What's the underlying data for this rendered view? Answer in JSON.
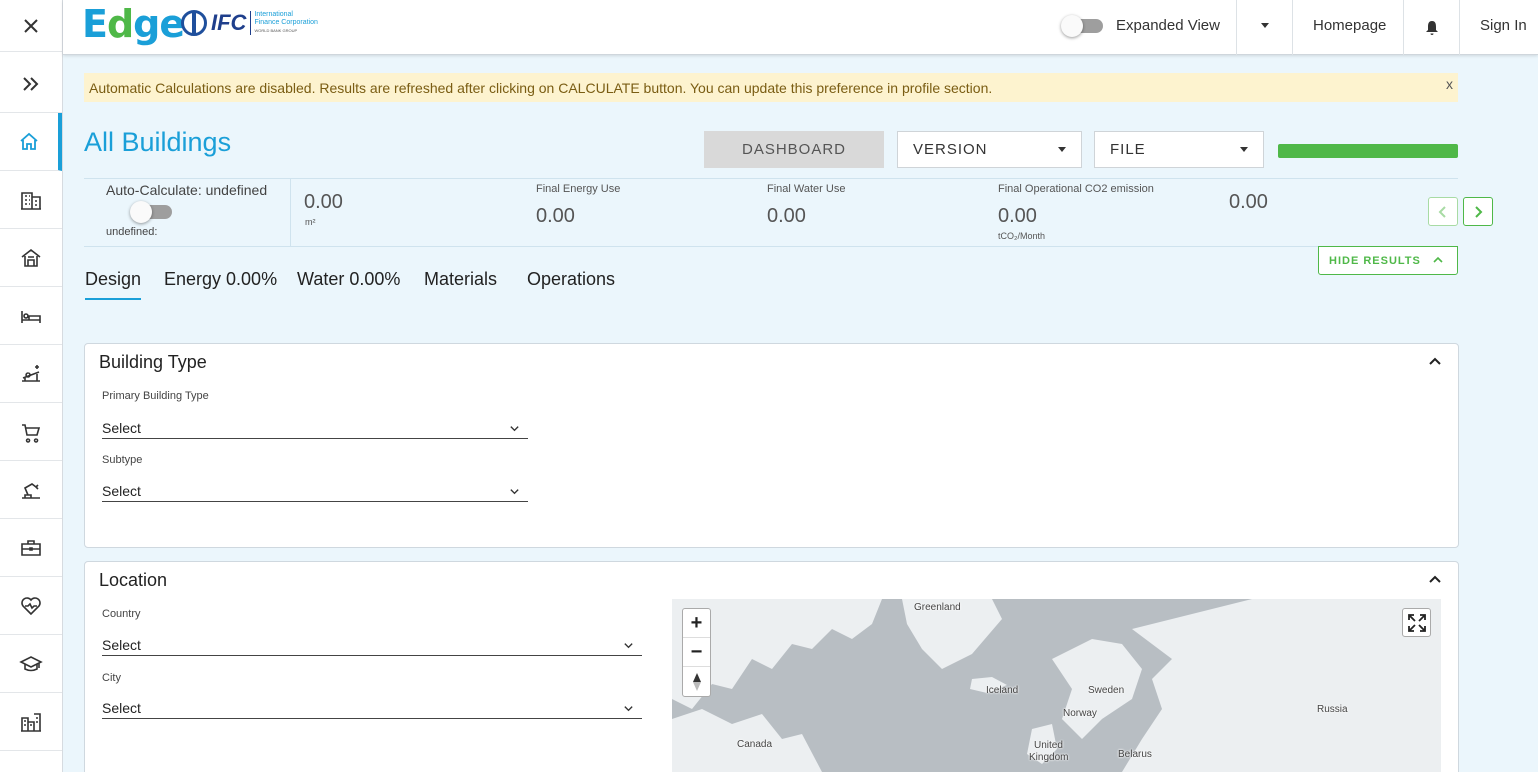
{
  "header": {
    "logo_text_e": "E",
    "logo_text_d": "d",
    "logo_text_ge": "ge",
    "ifc_text": "IFC",
    "ifc_sub1": "International",
    "ifc_sub2": "Finance Corporation",
    "ifc_sub3": "WORLD BANK GROUP",
    "expanded_view_label": "Expanded View",
    "homepage_label": "Homepage",
    "sign_in_label": "Sign In"
  },
  "banner": {
    "message": "Automatic Calculations are disabled. Results are refreshed after clicking on CALCULATE button. You can update this preference in profile section.",
    "close": "x"
  },
  "page": {
    "title": "All Buildings",
    "dashboard_label": "DASHBOARD",
    "version_label": "VERSION",
    "file_label": "FILE",
    "progress_fraction": 1.0
  },
  "stats": {
    "auto_calc_label": "Auto-Calculate: undefined",
    "auto_calc_sub": "undefined:",
    "area_value": "0.00",
    "area_unit": "m²",
    "energy_label": "Final Energy Use",
    "energy_value": "0.00",
    "water_label": "Final Water Use",
    "water_value": "0.00",
    "co2_label": "Final Operational CO2 emission",
    "co2_value": "0.00",
    "co2_unit": "tCO₂/Month",
    "extra_value": "0.00",
    "hide_results_label": "HIDE RESULTS"
  },
  "tabs": [
    {
      "label": "Design"
    },
    {
      "label": "Energy 0.00%"
    },
    {
      "label": "Water 0.00%"
    },
    {
      "label": "Materials"
    },
    {
      "label": "Operations"
    }
  ],
  "building_type": {
    "title": "Building Type",
    "primary_label": "Primary Building Type",
    "primary_value": "Select",
    "subtype_label": "Subtype",
    "subtype_value": "Select"
  },
  "location": {
    "title": "Location",
    "country_label": "Country",
    "country_value": "Select",
    "city_label": "City",
    "city_value": "Select",
    "map_labels": {
      "greenland": "Greenland",
      "iceland": "Iceland",
      "sweden": "Sweden",
      "norway": "Norway",
      "russia": "Russia",
      "canada": "Canada",
      "uk1": "United",
      "uk2": "Kingdom",
      "belarus": "Belarus"
    },
    "zoom_in": "+",
    "zoom_out": "−"
  },
  "colors": {
    "accent": "#1a9fd8",
    "green": "#4fb848",
    "banner_bg": "#fdf3cf",
    "page_bg": "#ebf6fc"
  }
}
